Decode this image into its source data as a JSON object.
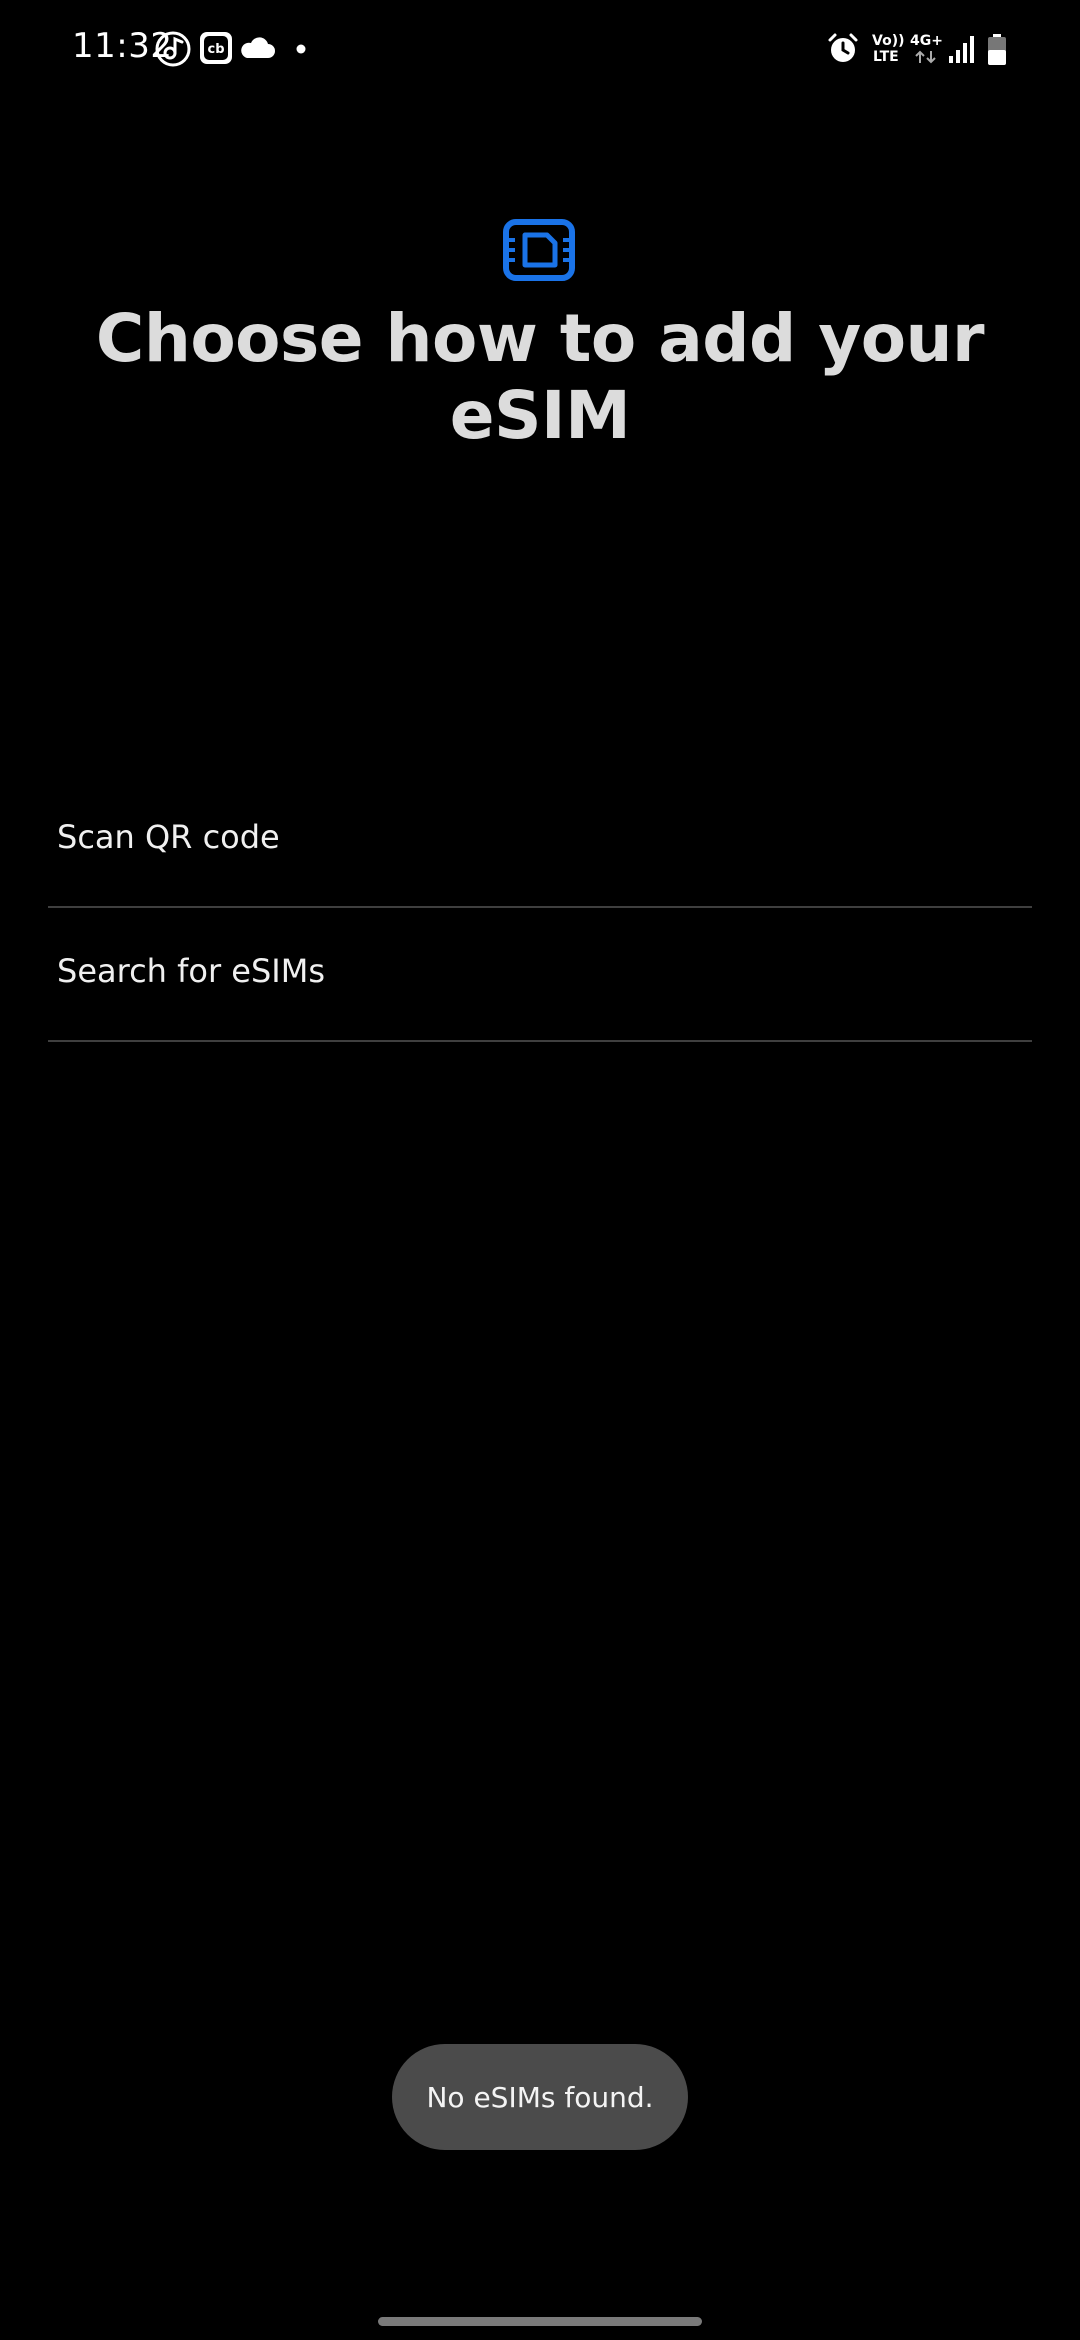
{
  "status_bar": {
    "time": "11:32",
    "icons": [
      "music-icon",
      "cb-app-icon",
      "cloud-icon",
      "dot-icon",
      "alarm-icon",
      "volte-icon",
      "4g-icon",
      "signal-icon",
      "battery-icon"
    ],
    "volte_line1": "Vo))",
    "volte_line2": "LTE",
    "network": "4G+"
  },
  "header": {
    "icon": "esim-card-icon",
    "accent_color": "#1a73e8",
    "title": "Choose how to add your eSIM"
  },
  "options": [
    {
      "label": "Scan QR code"
    },
    {
      "label": "Search for eSIMs"
    }
  ],
  "toast": {
    "message": "No eSIMs found."
  }
}
